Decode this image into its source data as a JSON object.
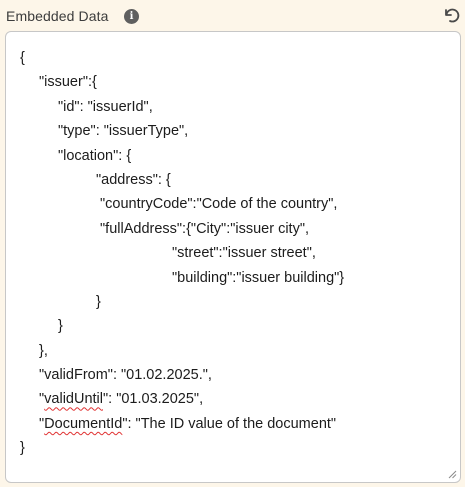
{
  "header": {
    "title": "Embedded Data",
    "info_icon": "info-icon",
    "reset_icon": "undo-icon"
  },
  "editor": {
    "lines": [
      {
        "indent": 0,
        "text": "{"
      },
      {
        "indent": 1,
        "text": "\"issuer\":{"
      },
      {
        "indent": 2,
        "text": "\"id\": \"issuerId\","
      },
      {
        "indent": 2,
        "text": "\"type\": \"issuerType\","
      },
      {
        "indent": 2,
        "text": "\"location\": {"
      },
      {
        "indent": 4,
        "text": "\"address\": {"
      },
      {
        "indent": 4,
        "text": " \"countryCode\":\"Code of the country\","
      },
      {
        "indent": 4,
        "text": " \"fullAddress\":{\"City\":\"issuer city\","
      },
      {
        "indent": 8,
        "text": "\"street\":\"issuer street\","
      },
      {
        "indent": 8,
        "text": "\"building\":\"issuer building\"}"
      },
      {
        "indent": 4,
        "text": "}"
      },
      {
        "indent": 2,
        "text": "}"
      },
      {
        "indent": 1,
        "text": "},"
      },
      {
        "indent": 1,
        "text": "\"validFrom\": \"01.02.2025.\","
      },
      {
        "indent": 1,
        "pre": "\"",
        "squiggle": "validUntil",
        "text": "\": \"01.03.2025\","
      },
      {
        "indent": 1,
        "pre": "\"",
        "squiggle": "DocumentId",
        "text": "\": \"The ID value of the document\""
      },
      {
        "indent": 0,
        "text": "}"
      }
    ]
  }
}
